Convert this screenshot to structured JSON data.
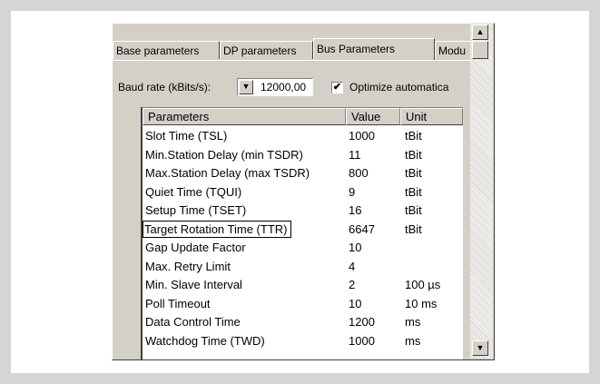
{
  "tabs": [
    {
      "label": "Base parameters"
    },
    {
      "label": "DP parameters"
    },
    {
      "label": "Bus Parameters",
      "active": true
    },
    {
      "label": "Modu"
    }
  ],
  "baud": {
    "label": "Baud rate (kBits/s):",
    "value": "12000,00"
  },
  "optimize": {
    "label": "Optimize automatica",
    "checked": true,
    "check_glyph": "✔"
  },
  "table": {
    "headers": [
      "Parameters",
      "Value",
      "Unit"
    ],
    "rows": [
      {
        "name": "Slot Time (TSL)",
        "value": "1000",
        "unit": "tBit"
      },
      {
        "name": "Min.Station Delay (min TSDR)",
        "value": "11",
        "unit": "tBit"
      },
      {
        "name": "Max.Station Delay (max TSDR)",
        "value": "800",
        "unit": "tBit"
      },
      {
        "name": "Quiet Time (TQUI)",
        "value": "9",
        "unit": "tBit"
      },
      {
        "name": "Setup Time (TSET)",
        "value": "16",
        "unit": "tBit"
      },
      {
        "name": "Target Rotation Time (TTR)",
        "value": "6647",
        "unit": "tBit",
        "focused": true
      },
      {
        "name": "Gap Update Factor",
        "value": "10",
        "unit": ""
      },
      {
        "name": "Max. Retry Limit",
        "value": "4",
        "unit": ""
      },
      {
        "name": "Min. Slave Interval",
        "value": "2",
        "unit": "100 µs"
      },
      {
        "name": "Poll Timeout",
        "value": "10",
        "unit": "10 ms"
      },
      {
        "name": "Data Control Time",
        "value": "1200",
        "unit": "ms"
      },
      {
        "name": "Watchdog Time (TWD)",
        "value": "1000",
        "unit": "ms"
      }
    ]
  },
  "icons": {
    "dropdown": "▼",
    "scroll_up": "▲",
    "scroll_down": "▼"
  }
}
